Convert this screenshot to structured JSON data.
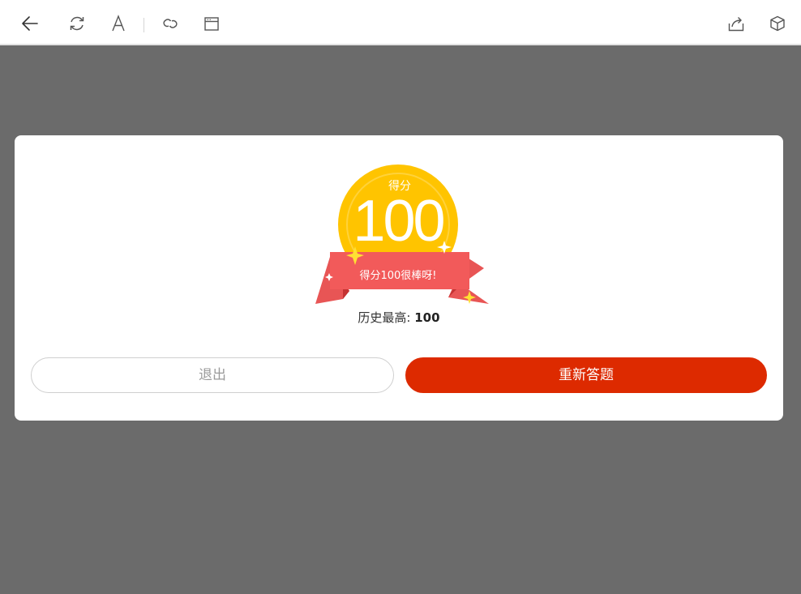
{
  "toolbar": {
    "icons": [
      "back-arrow-icon",
      "refresh-icon",
      "font-icon",
      "link-icon",
      "window-icon",
      "share-icon",
      "cube-icon"
    ]
  },
  "result": {
    "score_label": "得分",
    "score_value": "100",
    "ribbon_text": "得分100很棒呀!",
    "best_label": "历史最高: ",
    "best_value": "100",
    "exit_label": "退出",
    "retry_label": "重新答题"
  },
  "colors": {
    "overlay": "#6b6b6b",
    "medal": "#ffc400",
    "medal_inner": "#ffcf2a",
    "ribbon": "#f25a5a",
    "ribbon_dark": "#d83c3c",
    "retry_button": "#dd2a00"
  }
}
